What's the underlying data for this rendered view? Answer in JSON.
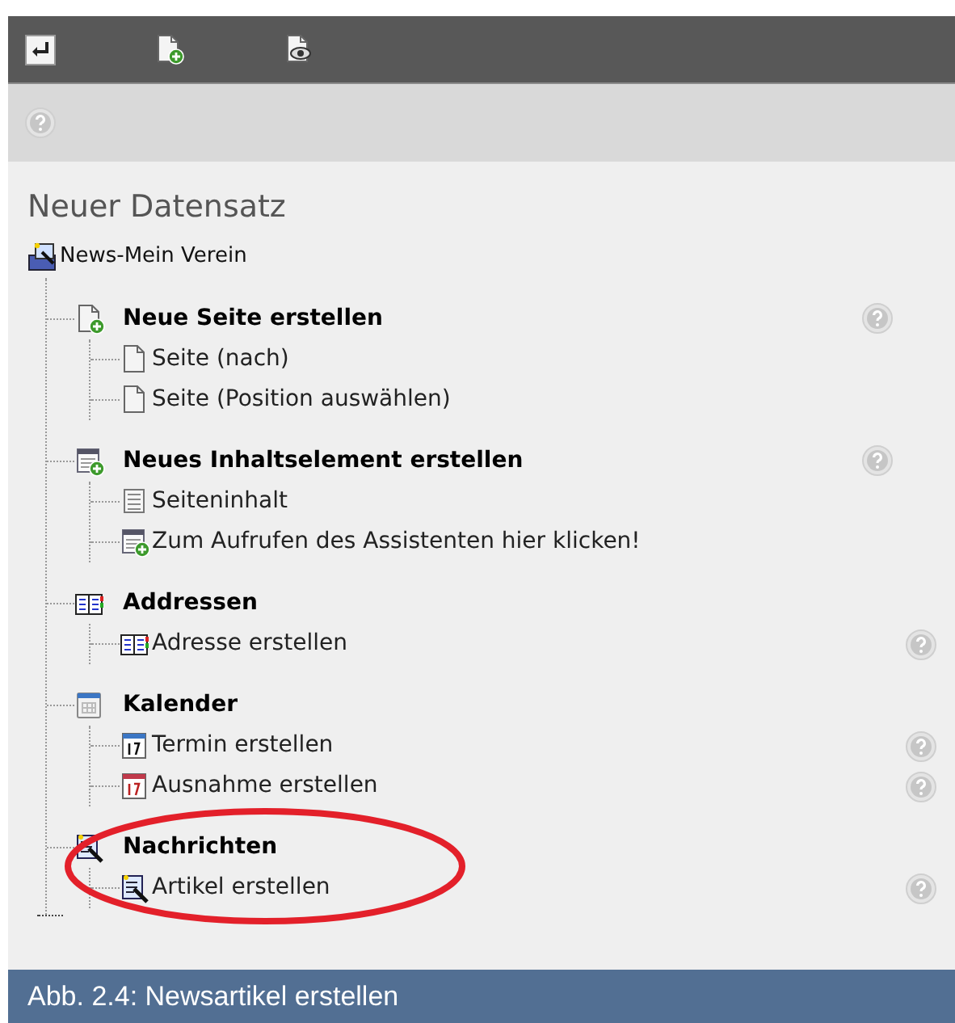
{
  "toolbar": {
    "buttons": [
      {
        "kind": "return"
      },
      {
        "kind": "new-page"
      },
      {
        "kind": "preview"
      }
    ]
  },
  "heading": "Neuer Datensatz",
  "root": {
    "label": "News-Mein Verein",
    "kind": "folder"
  },
  "groups": [
    {
      "label": "Neue Seite erstellen",
      "kind": "page-new",
      "help": true,
      "highlighted": false,
      "items": [
        {
          "label": "Seite (nach)",
          "kind": "page",
          "help": false
        },
        {
          "label": "Seite (Position auswählen)",
          "kind": "page",
          "help": false
        }
      ]
    },
    {
      "label": "Neues Inhaltselement erstellen",
      "kind": "content-new",
      "help": true,
      "highlighted": false,
      "items": [
        {
          "label": "Seiteninhalt",
          "kind": "content",
          "help": false
        },
        {
          "label": "Zum Aufrufen des Assistenten hier klicken!",
          "kind": "content-new",
          "help": false
        }
      ]
    },
    {
      "label": "Addressen",
      "kind": "address",
      "help": false,
      "highlighted": false,
      "items": [
        {
          "label": "Adresse erstellen",
          "kind": "address",
          "help": true
        }
      ]
    },
    {
      "label": "Kalender",
      "kind": "calendar",
      "help": false,
      "highlighted": false,
      "items": [
        {
          "label": "Termin erstellen",
          "kind": "event",
          "help": true
        },
        {
          "label": "Ausnahme erstellen",
          "kind": "exception",
          "help": true
        }
      ]
    },
    {
      "label": "Nachrichten",
      "kind": "news",
      "help": false,
      "highlighted": true,
      "items": [
        {
          "label": "Artikel erstellen",
          "kind": "news",
          "help": true
        }
      ]
    }
  ],
  "caption": "Abb. 2.4: Newsartikel erstellen"
}
